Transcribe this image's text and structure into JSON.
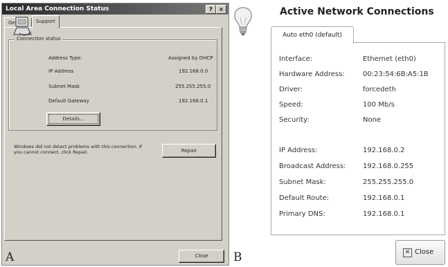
{
  "panel_a": {
    "window_title": "Local Area Connection Status",
    "titlebar_buttons": {
      "help": "?",
      "close": "×"
    },
    "tabs": [
      {
        "label": "General"
      },
      {
        "label": "Support"
      }
    ],
    "group_label": "Connection status",
    "fields": [
      {
        "label": "Address Type:",
        "value": "Assigned by DHCP"
      },
      {
        "label": "IP Address",
        "value": "192.168.0.0"
      },
      {
        "label": "Subnet Mask",
        "value": "255.255.255.0"
      },
      {
        "label": "Default Gateway",
        "value": "192.168.0.1"
      }
    ],
    "details_button": "Details...",
    "message": "Windows did not detect problems with this connection. If you cannot connect, click Repair.",
    "repair_button": "Repair",
    "close_button": "Close",
    "letter": "A"
  },
  "panel_b": {
    "title": "Active Network Connections",
    "tab_label": "Auto eth0 (default)",
    "rows": [
      {
        "label": "Interface:",
        "value": "Ethernet (eth0)"
      },
      {
        "label": "Hardware Address:",
        "value": "00:23:54:6B:A5:1B"
      },
      {
        "label": "Driver:",
        "value": "forcedeth"
      },
      {
        "label": "Speed:",
        "value": "100 Mb/s"
      },
      {
        "label": "Security:",
        "value": "None"
      },
      {
        "label": "IP Address:",
        "value": "192.168.0.2"
      },
      {
        "label": "Broadcast Address:",
        "value": "192.168.0.255"
      },
      {
        "label": "Subnet Mask:",
        "value": "255.255.255.0"
      },
      {
        "label": "Default Route:",
        "value": "192.168.0.1"
      },
      {
        "label": "Primary DNS:",
        "value": "192.168.0.1"
      }
    ],
    "close_button": "Close",
    "letter": "B"
  }
}
